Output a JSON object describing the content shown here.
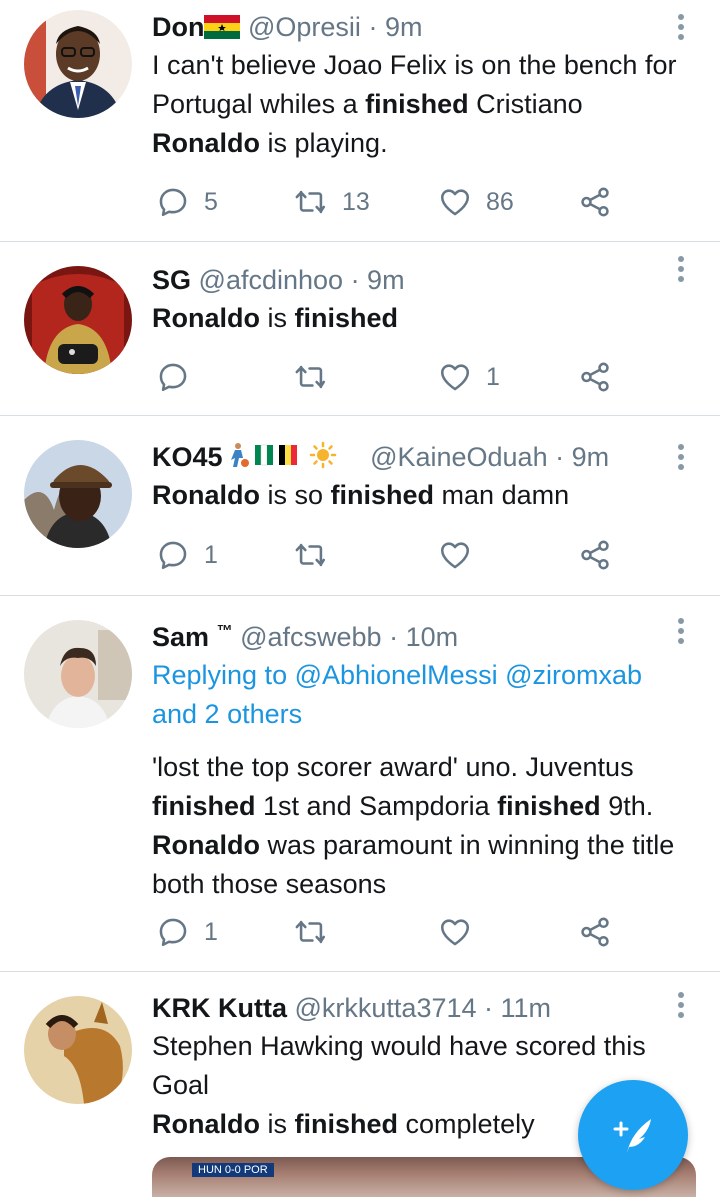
{
  "tweets": [
    {
      "name": "Don",
      "handle": "@Opresii",
      "time": "· 9m",
      "body_parts": [
        "I can't believe Joao Felix is on the bench for Portugal whiles a ",
        "finished",
        " Cristiano ",
        "Ronaldo",
        " is playing."
      ],
      "replies": "5",
      "retweets": "13",
      "likes": "86"
    },
    {
      "name": "SG",
      "handle": "@afcdinhoo",
      "time": "· 9m",
      "body_parts": [
        "Ronaldo",
        " is ",
        "finished"
      ],
      "replies": "",
      "retweets": "",
      "likes": "1"
    },
    {
      "name": "KO45",
      "handle": "@KaineOduah",
      "time": "· 9m",
      "body_parts": [
        "Ronaldo",
        " is so ",
        "finished",
        " man damn"
      ],
      "replies": "1",
      "retweets": "",
      "likes": ""
    },
    {
      "name": "Sam",
      "name_suffix": "™",
      "handle": "@afcswebb",
      "time": "· 10m",
      "reply_prefix": "Replying to ",
      "reply_users": "@AbhionelMessi @ziromxab",
      "reply_others": "and 2 others",
      "body_parts": [
        "'lost the top scorer award' uno. Juventus ",
        "finished",
        " 1st and Sampdoria ",
        "finished",
        " 9th. ",
        "Ronaldo",
        " was paramount in winning the title both those seasons"
      ],
      "replies": "1",
      "retweets": "",
      "likes": ""
    },
    {
      "name": "KRK Kutta",
      "handle": "@krkkutta3714",
      "time": "· 11m",
      "body_line1": "Stephen Hawking would have scored this Goal",
      "body_parts": [
        "Ronaldo",
        " is ",
        "finished",
        " completely"
      ],
      "media_scoreboard": "HUN 0-0 POR"
    }
  ],
  "icons": {
    "reply": "reply-icon",
    "retweet": "retweet-icon",
    "like": "heart-icon",
    "share": "share-icon",
    "more": "more-vertical-icon",
    "compose": "compose-tweet-icon"
  },
  "colors": {
    "link": "#1b95e0",
    "secondary": "#657786",
    "fab": "#1da1f2",
    "divider": "#d9dee2"
  }
}
